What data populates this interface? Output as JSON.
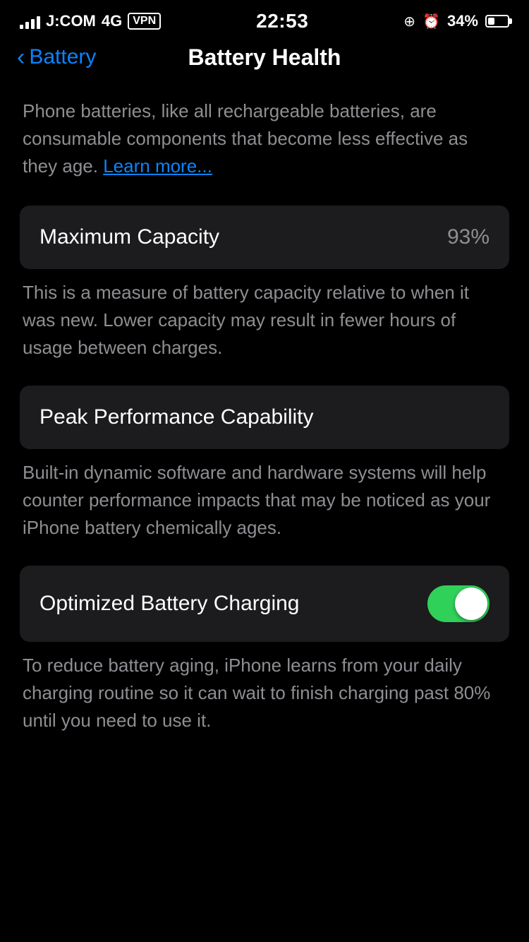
{
  "statusBar": {
    "carrier": "J:COM",
    "network": "4G",
    "vpn": "VPN",
    "time": "22:53",
    "batteryPercent": "34%"
  },
  "header": {
    "backLabel": "Battery",
    "title": "Battery Health"
  },
  "content": {
    "introText": "Phone batteries, like all rechargeable batteries, are consumable components that become less effective as they age.",
    "learnMore": "Learn more...",
    "maxCapacity": {
      "label": "Maximum Capacity",
      "value": "93%",
      "description": "This is a measure of battery capacity relative to when it was new. Lower capacity may result in fewer hours of usage between charges."
    },
    "peakPerformance": {
      "label": "Peak Performance Capability",
      "description": "Built-in dynamic software and hardware systems will help counter performance impacts that may be noticed as your iPhone battery chemically ages."
    },
    "optimizedCharging": {
      "label": "Optimized Battery Charging",
      "toggled": true,
      "description": "To reduce battery aging, iPhone learns from your daily charging routine so it can wait to finish charging past 80% until you need to use it."
    }
  }
}
